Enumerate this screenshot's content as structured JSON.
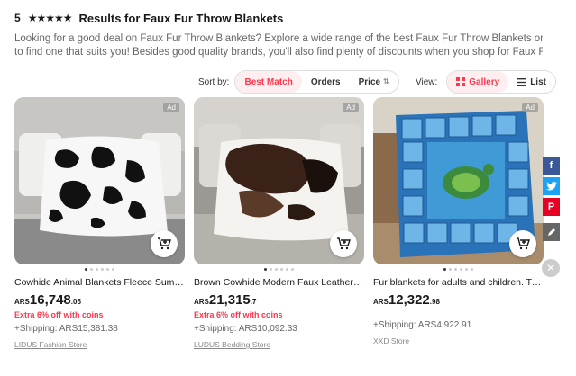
{
  "header": {
    "rating": "5",
    "title": "Results for Faux Fur Throw Blankets"
  },
  "description": {
    "line1": "Looking for a good deal on Faux Fur Throw Blankets? Explore a wide range of the best Faux Fur Throw Blankets on AliExpress",
    "line2": "to find one that suits you! Besides good quality brands, you'll also find plenty of discounts when you shop for Faux Fur Throw..."
  },
  "sort": {
    "label": "Sort by:",
    "options": [
      "Best Match",
      "Orders",
      "Price"
    ]
  },
  "view": {
    "label": "View:",
    "gallery": "Gallery",
    "list": "List"
  },
  "products": [
    {
      "ad": "Ad",
      "title": "Cowhide Animal Blankets Fleece Summer ...",
      "currency": "ARS",
      "price_main": "16,748",
      "price_dec": ".05",
      "promo": "Extra 6% off with coins",
      "shipping": "+Shipping: ARS15,381.38",
      "store": "LIDUS Fashion Store"
    },
    {
      "ad": "Ad",
      "title": "Brown Cowhide Modern Faux Leather Flan...",
      "currency": "ARS",
      "price_main": "21,315",
      "price_dec": ".7",
      "promo": "Extra 6% off with coins",
      "shipping": "+Shipping: ARS10,092.33",
      "store": "LUDUS Bedding Store"
    },
    {
      "ad": "Ad",
      "title": "Fur blankets for adults and children. Turtle...",
      "currency": "ARS",
      "price_main": "12,322",
      "price_dec": ".98",
      "promo": "",
      "shipping": "+Shipping: ARS4,922.91",
      "store": "XXD Store"
    }
  ],
  "share": {
    "facebook": "f",
    "pinterest": "P"
  },
  "colors": {
    "accent": "#fd384f",
    "facebook": "#3b5998",
    "twitter": "#1da1f2",
    "pinterest": "#e60023",
    "edit": "#666666"
  }
}
